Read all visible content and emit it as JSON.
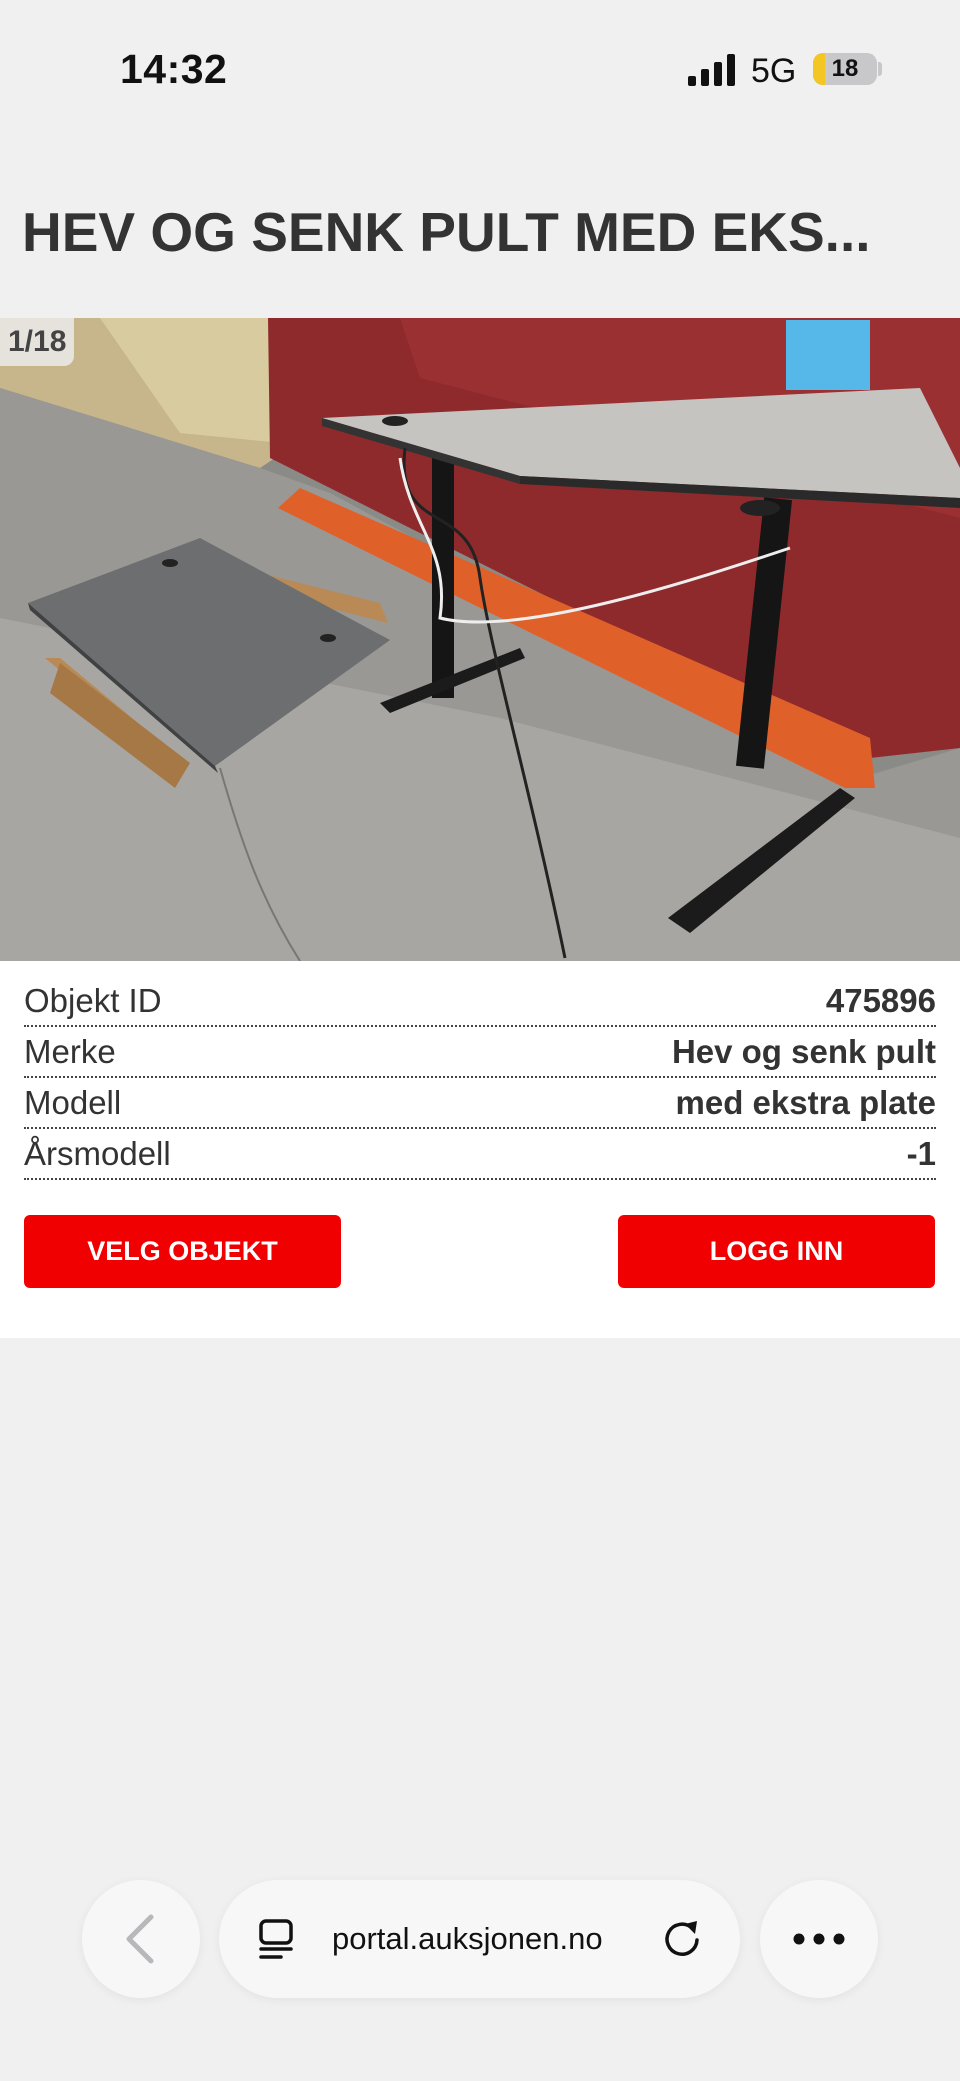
{
  "status_bar": {
    "time": "14:32",
    "network": "5G",
    "battery_level": 18,
    "battery_label": "18",
    "battery_color": "#f3c623"
  },
  "page": {
    "title": "HEV OG SENK PULT MED EKS..."
  },
  "photo": {
    "counter": "1/18",
    "subject": "electric sit-stand desk with grey top and black frame, extra grey desk plate on wooden pallet"
  },
  "specs": [
    {
      "label": "Objekt ID",
      "value": "475896"
    },
    {
      "label": "Merke",
      "value": "Hev og senk pult"
    },
    {
      "label": "Modell",
      "value": "med ekstra plate"
    },
    {
      "label": "Årsmodell",
      "value": "-1"
    }
  ],
  "actions": {
    "select_label": "VELG OBJEKT",
    "login_label": "LOGG INN",
    "accent_color": "#f00000"
  },
  "browser": {
    "url": "portal.auksjonen.no",
    "icons": [
      "chevron-left-icon",
      "page-menu-icon",
      "reload-icon",
      "more-icon"
    ]
  }
}
